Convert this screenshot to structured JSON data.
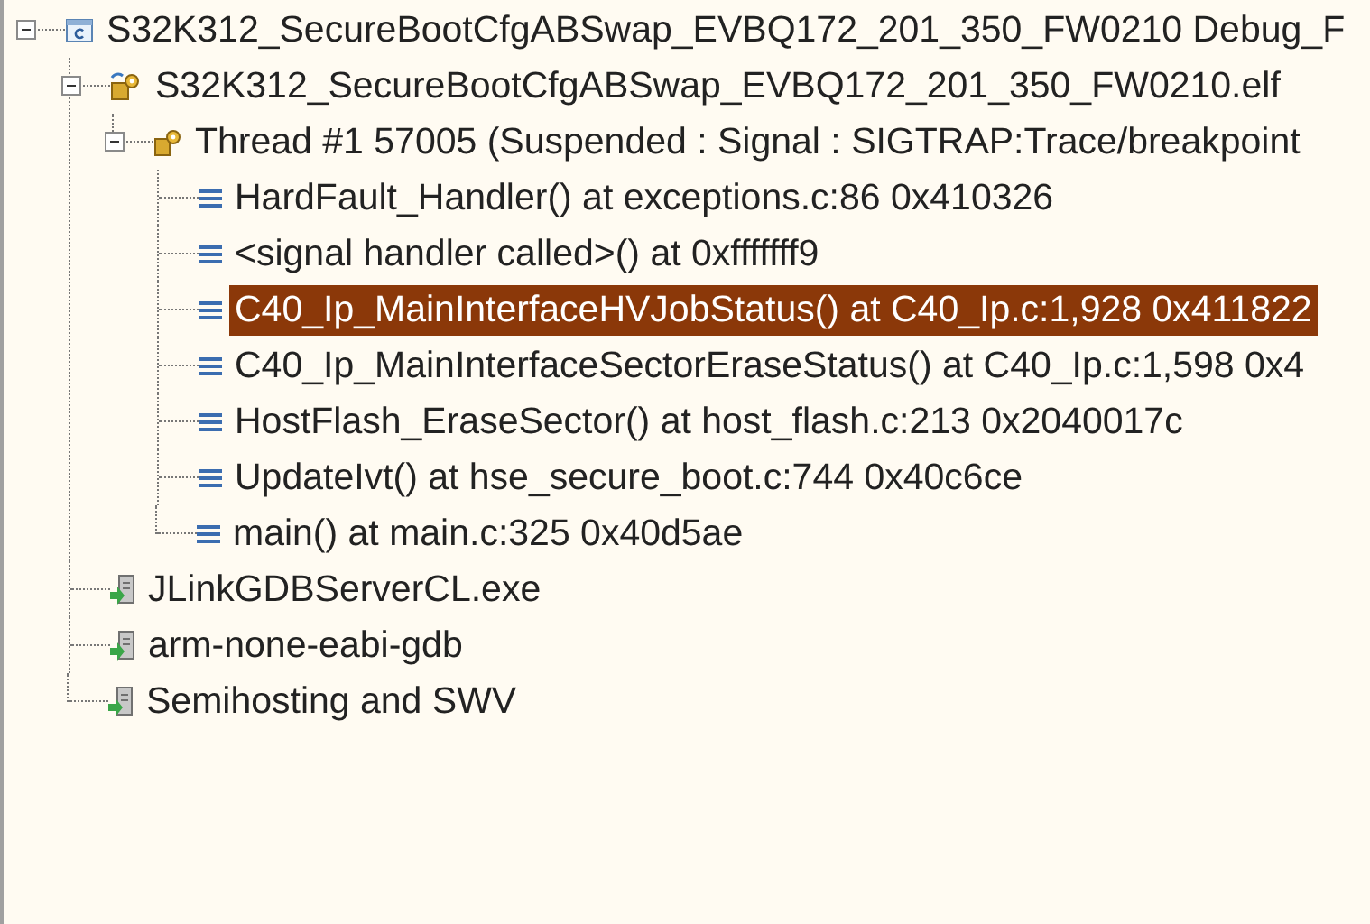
{
  "tree": [
    {
      "kind": "launch",
      "label": "S32K312_SecureBootCfgABSwap_EVBQ172_201_350_FW0210 Debug_F",
      "selected": false,
      "expanded": true,
      "children": [
        {
          "kind": "target",
          "label": "S32K312_SecureBootCfgABSwap_EVBQ172_201_350_FW0210.elf",
          "selected": false,
          "expanded": true,
          "children": [
            {
              "kind": "thread",
              "label": "Thread #1 57005 (Suspended : Signal : SIGTRAP:Trace/breakpoint",
              "selected": false,
              "expanded": true,
              "children": [
                {
                  "kind": "frame",
                  "label": "HardFault_Handler() at exceptions.c:86 0x410326",
                  "selected": false
                },
                {
                  "kind": "frame",
                  "label": "<signal handler called>() at 0xfffffff9",
                  "selected": false
                },
                {
                  "kind": "frame",
                  "label": "C40_Ip_MainInterfaceHVJobStatus() at C40_Ip.c:1,928 0x411822",
                  "selected": true
                },
                {
                  "kind": "frame",
                  "label": "C40_Ip_MainInterfaceSectorEraseStatus() at C40_Ip.c:1,598 0x4",
                  "selected": false
                },
                {
                  "kind": "frame",
                  "label": "HostFlash_EraseSector() at host_flash.c:213 0x2040017c",
                  "selected": false
                },
                {
                  "kind": "frame",
                  "label": "UpdateIvt() at hse_secure_boot.c:744 0x40c6ce",
                  "selected": false
                },
                {
                  "kind": "frame",
                  "label": "main() at main.c:325 0x40d5ae",
                  "selected": false
                }
              ]
            }
          ]
        },
        {
          "kind": "process",
          "label": "JLinkGDBServerCL.exe",
          "selected": false
        },
        {
          "kind": "process",
          "label": "arm-none-eabi-gdb",
          "selected": false
        },
        {
          "kind": "process",
          "label": "Semihosting and SWV",
          "selected": false
        }
      ]
    }
  ]
}
